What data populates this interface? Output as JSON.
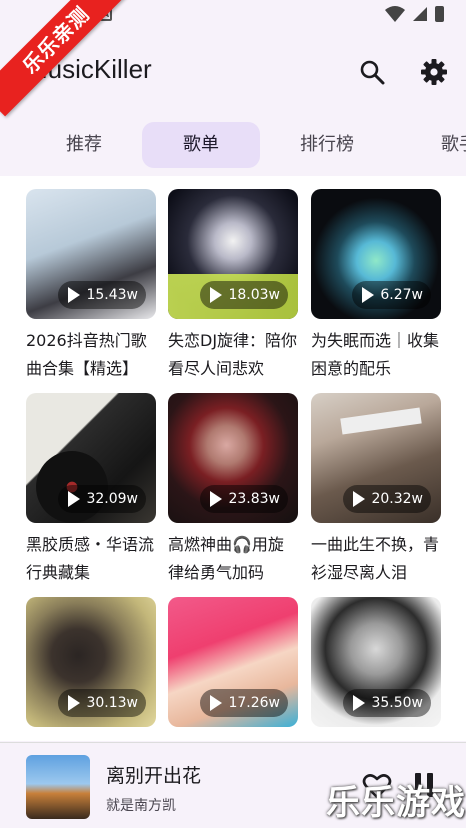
{
  "status_bar": {
    "left_icon": "A",
    "right_icons": [
      "wifi-icon",
      "signal-icon",
      "battery-icon"
    ]
  },
  "badge": {
    "text": "乐乐亲测"
  },
  "app_bar": {
    "title": "MusicKiller",
    "search_icon": "search-icon",
    "settings_icon": "gear-icon"
  },
  "tabs": [
    {
      "label": "推荐",
      "active": false
    },
    {
      "label": "歌单",
      "active": true
    },
    {
      "label": "排行榜",
      "active": false
    },
    {
      "label": "歌手",
      "active": false
    }
  ],
  "playlists": [
    {
      "count": "15.43w",
      "title": "2026抖音热门歌曲合集【精选】"
    },
    {
      "count": "18.03w",
      "title": "失恋DJ旋律：陪你看尽人间悲欢"
    },
    {
      "count": "6.27w",
      "title": "为失眠而选｜收集困意的配乐"
    },
    {
      "count": "32.09w",
      "title": "黑胶质感・华语流行典藏集"
    },
    {
      "count": "23.83w",
      "title": "高燃神曲🎧用旋律给勇气加码"
    },
    {
      "count": "20.32w",
      "title": "一曲此生不换，青衫湿尽离人泪"
    },
    {
      "count": "30.13w",
      "title": ""
    },
    {
      "count": "17.26w",
      "title": ""
    },
    {
      "count": "35.50w",
      "title": ""
    }
  ],
  "player": {
    "song_title": "离别开出花",
    "artist": "就是南方凯",
    "fav_icon": "heart-outline-icon",
    "pause_icon": "pause-icon"
  },
  "watermark": "乐乐游戏",
  "colors": {
    "active_tab_bg": "#e8def8",
    "badge": "#e8221f",
    "background": "#f7f2fa"
  }
}
